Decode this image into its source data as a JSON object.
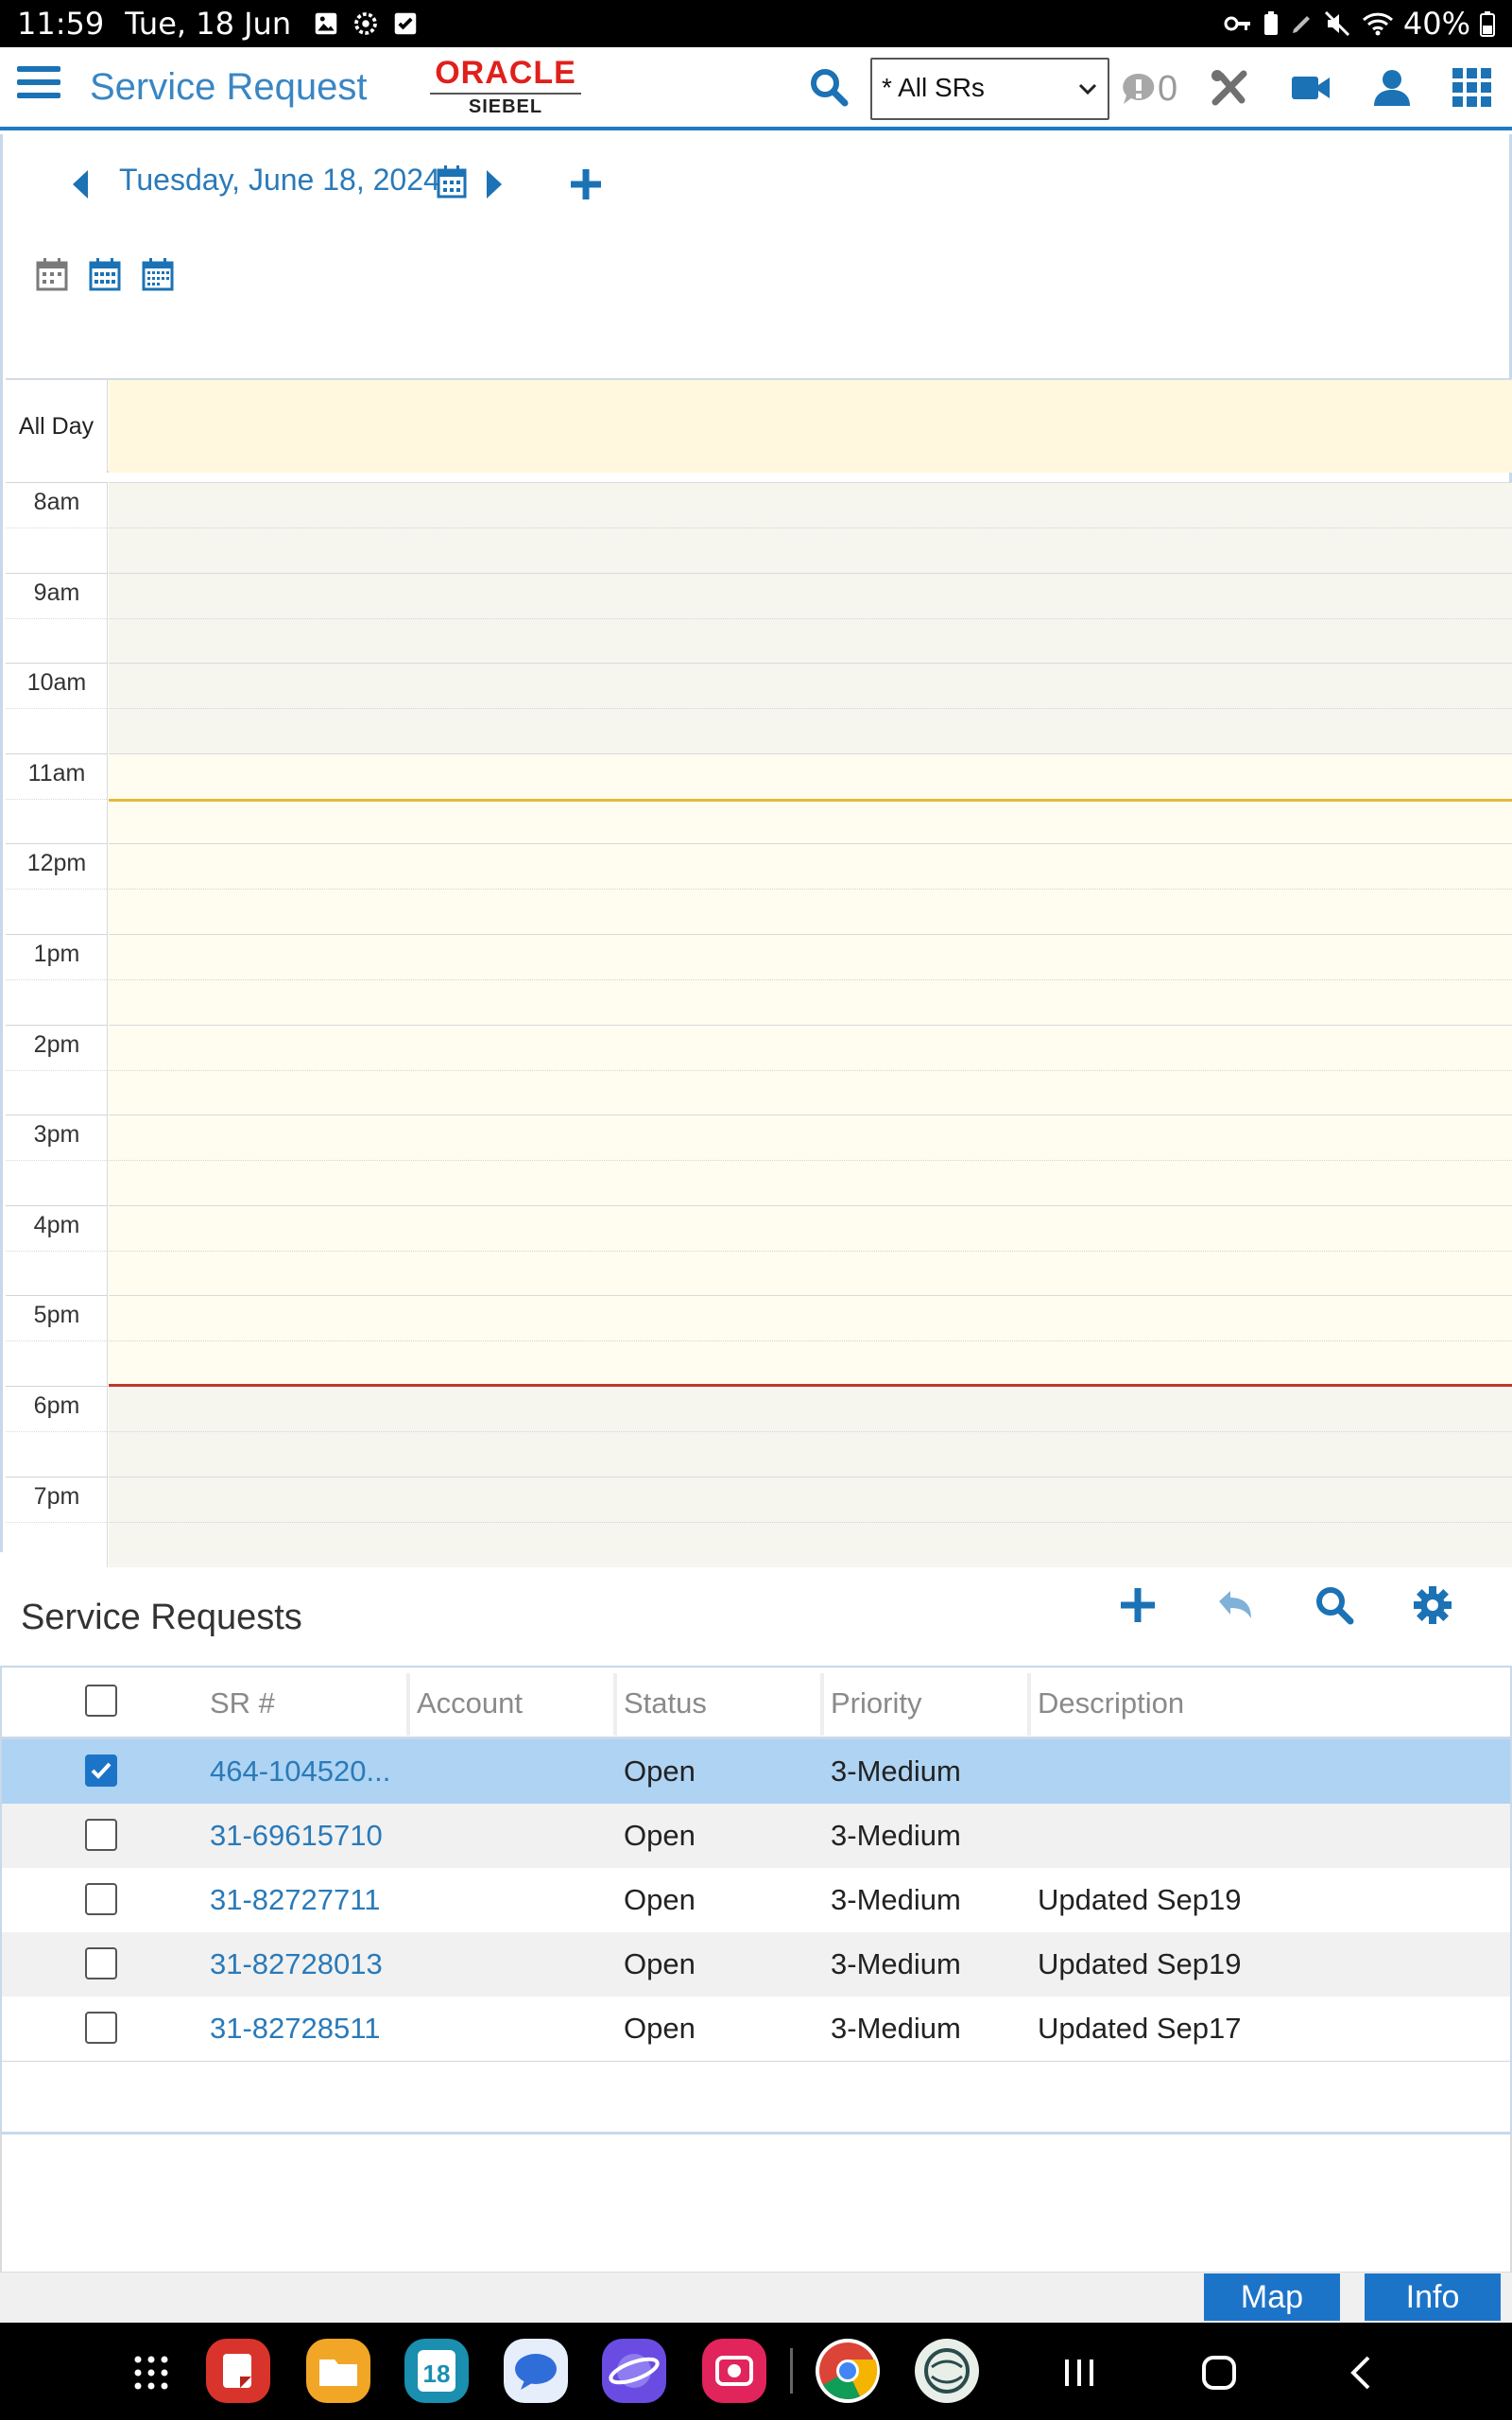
{
  "status_bar": {
    "time": "11:59",
    "date": "Tue, 18 Jun",
    "battery": "40%"
  },
  "header": {
    "app_title": "Service Request",
    "logo_brand": "ORACLE",
    "logo_product": "SIEBEL",
    "query_select_value": "* All SRs",
    "notification_count": "0",
    "accent_color": "#1b72b5"
  },
  "calendar": {
    "date_label": "Tuesday, June 18, 2024",
    "all_day_label": "All Day",
    "hours": [
      "8am",
      "9am",
      "10am",
      "11am",
      "12pm",
      "1pm",
      "2pm",
      "3pm",
      "4pm",
      "5pm",
      "6pm",
      "7pm"
    ],
    "view_icons": [
      "day-view-icon",
      "week-view-icon",
      "month-view-icon"
    ]
  },
  "service_requests": {
    "title": "Service Requests",
    "columns": [
      "SR #",
      "Account",
      "Status",
      "Priority",
      "Description"
    ],
    "rows": [
      {
        "sr": "464-104520...",
        "account": "",
        "status": "Open",
        "priority": "3-Medium",
        "description": "",
        "checked": true
      },
      {
        "sr": "31-69615710",
        "account": "",
        "status": "Open",
        "priority": "3-Medium",
        "description": "",
        "checked": false
      },
      {
        "sr": "31-82727711",
        "account": "",
        "status": "Open",
        "priority": "3-Medium",
        "description": "Updated Sep19",
        "checked": false
      },
      {
        "sr": "31-82728013",
        "account": "",
        "status": "Open",
        "priority": "3-Medium",
        "description": "Updated Sep19",
        "checked": false
      },
      {
        "sr": "31-82728511",
        "account": "",
        "status": "Open",
        "priority": "3-Medium",
        "description": "Updated Sep17",
        "checked": false
      }
    ]
  },
  "action_bar": {
    "map_label": "Map",
    "info_label": "Info"
  },
  "nav_bar": {
    "calendar_app_day": "18"
  }
}
